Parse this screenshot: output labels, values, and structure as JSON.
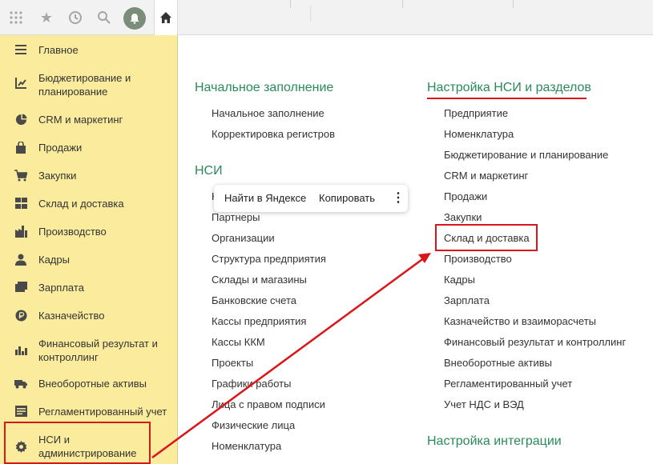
{
  "toolbar": {
    "apps_icon": "grid-icon",
    "favorites_icon": "star-icon",
    "history_icon": "history-icon",
    "search_icon": "search-icon",
    "notifications_icon": "bell-icon",
    "home_icon": "home-icon"
  },
  "sidebar": {
    "items": [
      {
        "label": "Главное",
        "icon": "menu-icon"
      },
      {
        "label": "Бюджетирование и планирование",
        "icon": "budget-icon"
      },
      {
        "label": "CRM и маркетинг",
        "icon": "pie-chart-icon"
      },
      {
        "label": "Продажи",
        "icon": "shopping-bag-icon"
      },
      {
        "label": "Закупки",
        "icon": "cart-icon"
      },
      {
        "label": "Склад и доставка",
        "icon": "warehouse-icon"
      },
      {
        "label": "Производство",
        "icon": "factory-icon"
      },
      {
        "label": "Кадры",
        "icon": "person-icon"
      },
      {
        "label": "Зарплата",
        "icon": "payroll-icon"
      },
      {
        "label": "Казначейство",
        "icon": "ruble-icon"
      },
      {
        "label": "Финансовый результат и контроллинг",
        "icon": "bar-chart-icon"
      },
      {
        "label": "Внеоборотные активы",
        "icon": "truck-icon"
      },
      {
        "label": "Регламентированный учет",
        "icon": "document-icon"
      },
      {
        "label": "НСИ и администрирование",
        "icon": "gear-icon"
      }
    ]
  },
  "main": {
    "initial_fill": {
      "title": "Начальное заполнение",
      "links": [
        "Начальное заполнение",
        "Корректировка регистров"
      ]
    },
    "nsi": {
      "title": "НСИ",
      "first_link_fragment": "К",
      "links": [
        "Партнеры",
        "Организации",
        "Структура предприятия",
        "Склады и магазины",
        "Банковские счета",
        "Кассы предприятия",
        "Кассы ККМ",
        "Проекты",
        "Графики работы",
        "Лица с правом подписи",
        "Физические лица",
        "Номенклатура"
      ]
    },
    "nsi_settings": {
      "title": "Настройка НСИ и разделов",
      "links": [
        "Предприятие",
        "Номенклатура",
        "Бюджетирование и планирование",
        "CRM и маркетинг",
        "Продажи",
        "Закупки",
        "Склад и доставка",
        "Производство",
        "Кадры",
        "Зарплата",
        "Казначейство и взаиморасчеты",
        "Финансовый результат и контроллинг",
        "Внеоборотные активы",
        "Регламентированный учет",
        "Учет НДС и ВЭД"
      ]
    },
    "integration": {
      "title": "Настройка интеграции"
    }
  },
  "context_menu": {
    "search_label": "Найти в Яндексе",
    "copy_label": "Копировать",
    "more_icon": "more-vertical-icon"
  },
  "colors": {
    "sidebar_bg": "#fbec9d",
    "section_title": "#2a8a5a",
    "annotation_red": "#d9161a"
  }
}
